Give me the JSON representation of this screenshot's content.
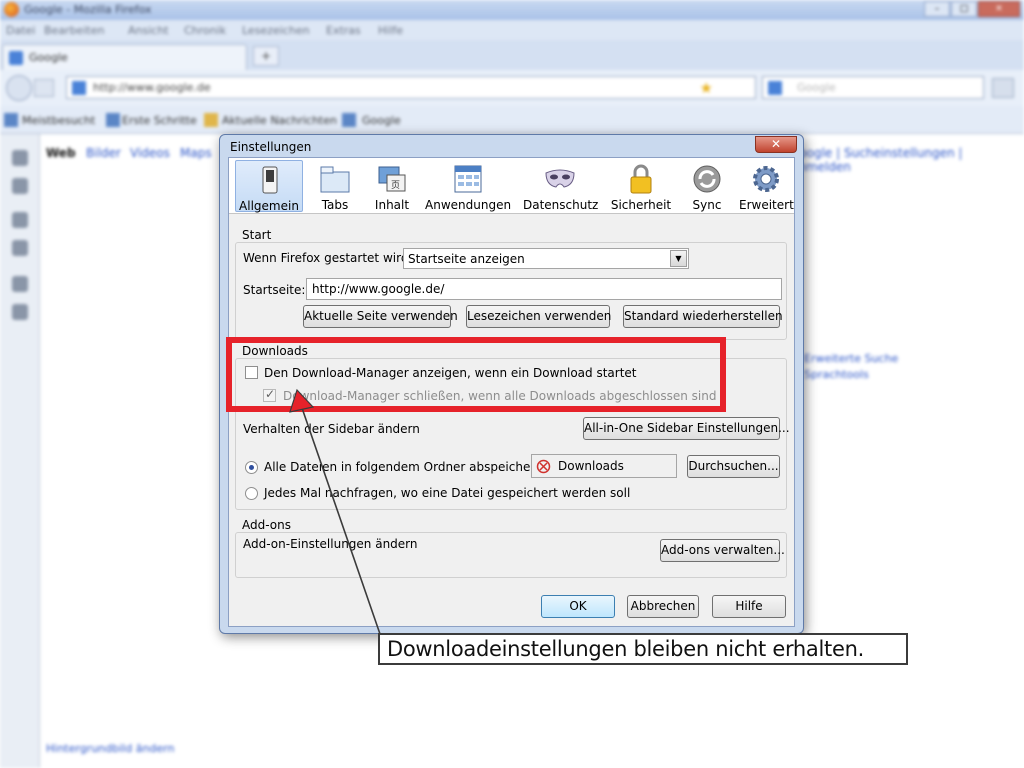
{
  "browser": {
    "window_title": "Google - Mozilla Firefox",
    "menu": [
      "Datei",
      "Bearbeiten",
      "Ansicht",
      "Chronik",
      "Lesezeichen",
      "Extras",
      "Hilfe"
    ],
    "tab_title": "Google",
    "url": "http://www.google.de",
    "search_placeholder": "Google",
    "bookmarks": [
      "Meistbesucht",
      "Erste Schritte",
      "Aktuelle Nachrichten",
      "Google"
    ],
    "content_links": [
      "Web",
      "Bilder",
      "Videos",
      "Maps"
    ],
    "right_links": "Google | Sucheinstellungen | Anmelden",
    "side_link_1": "Erweiterte Suche",
    "side_link_2": "Sprachtools",
    "bottom_link": "Hintergrundbild ändern"
  },
  "dialog": {
    "title": "Einstellungen",
    "close_glyph": "✕",
    "panes": [
      {
        "label": "Allgemein",
        "icon": "switch-icon",
        "selected": true
      },
      {
        "label": "Tabs",
        "icon": "tabs-icon"
      },
      {
        "label": "Inhalt",
        "icon": "content-icon"
      },
      {
        "label": "Anwendungen",
        "icon": "applications-icon"
      },
      {
        "label": "Datenschutz",
        "icon": "privacy-mask-icon"
      },
      {
        "label": "Sicherheit",
        "icon": "padlock-icon"
      },
      {
        "label": "Sync",
        "icon": "sync-icon"
      },
      {
        "label": "Erweitert",
        "icon": "gear-icon"
      }
    ],
    "start": {
      "group_label": "Start",
      "startup_label": "Wenn Firefox gestartet wird:",
      "startup_value": "Startseite anzeigen",
      "homepage_label": "Startseite:",
      "homepage_value": "http://www.google.de/",
      "btn_current": "Aktuelle Seite verwenden",
      "btn_bookmark": "Lesezeichen verwenden",
      "btn_default": "Standard wiederherstellen"
    },
    "downloads": {
      "group_label": "Downloads",
      "show_manager": "Den Download-Manager anzeigen, wenn ein Download startet",
      "close_manager": "Download-Manager schließen, wenn alle Downloads abgeschlossen sind",
      "sidebar_label": "Verhalten der Sidebar ändern",
      "btn_sidebar": "All-in-One Sidebar Einstellungen...",
      "save_to": "Alle Dateien in folgendem Ordner abspeichern:",
      "folder": "Downloads",
      "btn_browse": "Durchsuchen...",
      "ask": "Jedes Mal nachfragen, wo eine Datei gespeichert werden soll"
    },
    "addons": {
      "group_label": "Add-ons",
      "label": "Add-on-Einstellungen ändern",
      "btn_manage": "Add-ons verwalten..."
    },
    "ok": "OK",
    "cancel": "Abbrechen",
    "help": "Hilfe"
  },
  "annotation": {
    "callout": "Downloadeinstellungen bleiben nicht erhalten.",
    "box_color": "#e6222a"
  }
}
